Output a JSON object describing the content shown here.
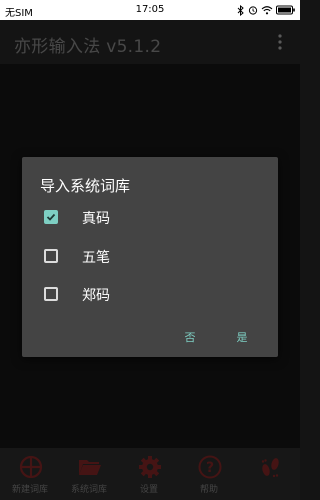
{
  "status_bar": {
    "carrier": "无SIM",
    "time": "17:05"
  },
  "app_bar": {
    "title": "亦形输入法 v5.1.2",
    "menu_icon": "more-vert-icon"
  },
  "dialog": {
    "title": "导入系统词库",
    "options": [
      {
        "label": "真码",
        "checked": true
      },
      {
        "label": "五笔",
        "checked": false
      },
      {
        "label": "郑码",
        "checked": false
      }
    ],
    "negative_label": "否",
    "positive_label": "是"
  },
  "bottom_nav": {
    "items": [
      {
        "label": "新建词库",
        "icon": "crosshair-icon"
      },
      {
        "label": "系统词库",
        "icon": "folder-icon"
      },
      {
        "label": "设置",
        "icon": "gear-icon"
      },
      {
        "label": "帮助",
        "icon": "help-icon"
      },
      {
        "label": "",
        "icon": "footprints-icon"
      }
    ]
  },
  "colors": {
    "accent": "#7ecfc3",
    "dialog_bg": "#444444",
    "nav_bg": "#242424",
    "nav_icon_red": "#6b1f1f"
  }
}
